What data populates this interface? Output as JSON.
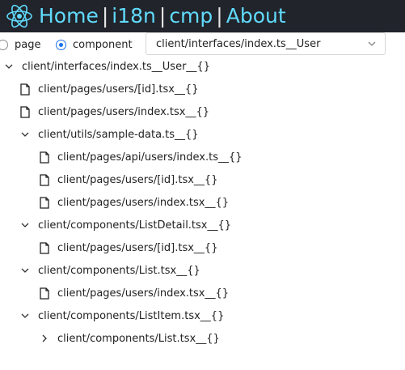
{
  "header": {
    "logo_icon": "react-atom-icon",
    "nav": [
      {
        "label": "Home"
      },
      {
        "label": "i18n"
      },
      {
        "label": "cmp"
      },
      {
        "label": "About"
      }
    ],
    "separator": "|",
    "accent": "#61dafb",
    "background": "#21242b"
  },
  "controls": {
    "mode_options": [
      {
        "label": "page",
        "selected": false
      },
      {
        "label": "component",
        "selected": true
      }
    ],
    "select_value": "client/interfaces/index.ts__User"
  },
  "tree": {
    "root": "client/interfaces/index.ts__User__{}",
    "items": [
      {
        "label": "client/pages/users/[id].tsx__{}",
        "type": "file"
      },
      {
        "label": "client/pages/users/index.tsx__{}",
        "type": "file"
      },
      {
        "label": "client/utils/sample-data.ts__{}",
        "type": "folder-open"
      },
      {
        "label": "client/pages/api/users/index.ts__{}",
        "type": "file"
      },
      {
        "label": "client/pages/users/[id].tsx__{}",
        "type": "file"
      },
      {
        "label": "client/pages/users/index.tsx__{}",
        "type": "file"
      },
      {
        "label": "client/components/ListDetail.tsx__{}",
        "type": "folder-open"
      },
      {
        "label": "client/pages/users/[id].tsx__{}",
        "type": "file"
      },
      {
        "label": "client/components/List.tsx__{}",
        "type": "folder-open"
      },
      {
        "label": "client/pages/users/index.tsx__{}",
        "type": "file"
      },
      {
        "label": "client/components/ListItem.tsx__{}",
        "type": "folder-open"
      },
      {
        "label": "client/components/List.tsx__{}",
        "type": "folder-closed"
      }
    ]
  }
}
